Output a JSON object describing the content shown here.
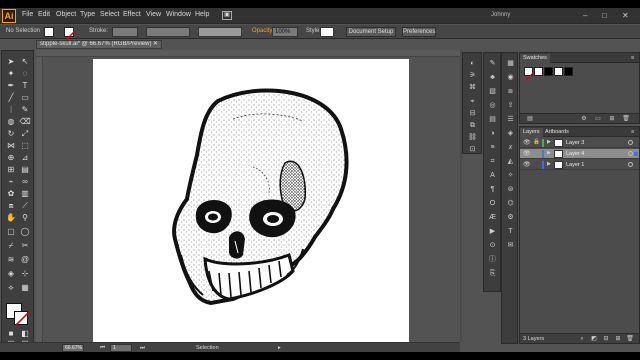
{
  "app": {
    "logo": "Ai",
    "user": "Johnny"
  },
  "menu": [
    "File",
    "Edit",
    "Object",
    "Type",
    "Select",
    "Effect",
    "View",
    "Window",
    "Help"
  ],
  "window_controls": {
    "minimize": "–",
    "maximize": "□",
    "close": "✕"
  },
  "control_bar": {
    "selection_label": "No Selection",
    "stroke_label": "Stroke:",
    "opacity_label": "Opacity:",
    "opacity_value": "100%",
    "style_label": "Style:",
    "document_setup": "Document Setup",
    "preferences": "Preferences"
  },
  "document": {
    "tab_title": "stipple-skull.ai* @ 66.67% (RGB/Preview)",
    "close": "✕"
  },
  "status_bar": {
    "zoom": "66.67%",
    "artboard": "1",
    "tool": "Selection"
  },
  "swatches_panel": {
    "title": "Swatches",
    "colors": [
      "#ffffff",
      "#000000",
      "#ffffff",
      "#000000"
    ]
  },
  "layers_panel": {
    "tabs": [
      "Layers",
      "Artboards"
    ],
    "layers": [
      {
        "name": "Layer 3",
        "color": "#3fb34f",
        "locked": true,
        "selected": false
      },
      {
        "name": "Layer 4",
        "color": "#4f6fdf",
        "locked": false,
        "selected": true
      },
      {
        "name": "Layer 1",
        "color": "#3f6fdf",
        "locked": false,
        "selected": false
      }
    ],
    "footer": "3 Layers"
  },
  "colors": {
    "accent": "#f7a31c",
    "ui_dark": "#323232",
    "ui_mid": "#535353"
  }
}
